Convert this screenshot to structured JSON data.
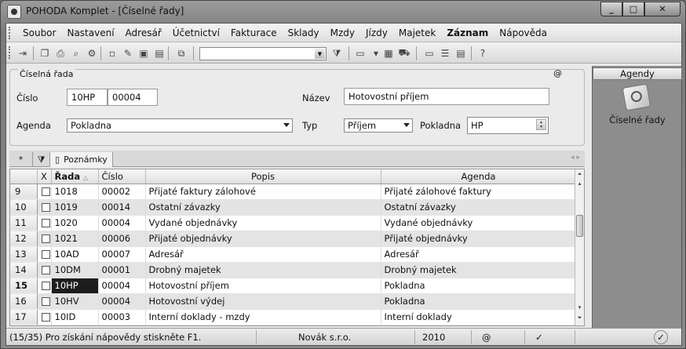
{
  "window": {
    "title": "POHODA Komplet - [Číselné řady]",
    "minimize": "_",
    "maximize": "□",
    "close": "✕"
  },
  "menu": {
    "items": [
      "Soubor",
      "Nastavení",
      "Adresář",
      "Účetnictví",
      "Fakturace",
      "Sklady",
      "Mzdy",
      "Jízdy",
      "Majetek",
      "Záznam",
      "Nápověda"
    ]
  },
  "form": {
    "section_title": "Číselná řada",
    "at_symbol": "@",
    "cislo_label": "Číslo",
    "cislo_rada": "10HP",
    "cislo_number": "00004",
    "nazev_label": "Název",
    "nazev_value": "Hotovostní příjem",
    "agenda_label": "Agenda",
    "agenda_value": "Pokladna",
    "typ_label": "Typ",
    "typ_value": "Příjem",
    "pokladna_label": "Pokladna",
    "pokladna_value": "HP"
  },
  "sidebar": {
    "header": "Agendy",
    "item_label": "Číselné řady"
  },
  "tabs": {
    "star": "*",
    "notes": "Poznámky"
  },
  "table": {
    "columns": [
      "X",
      "Řada",
      "Číslo",
      "Popis",
      "Agenda"
    ],
    "rows": [
      {
        "n": "9",
        "rada": "1018",
        "cislo": "00002",
        "popis": "Přijaté faktury zálohové",
        "agenda": "Přijaté zálohové faktury"
      },
      {
        "n": "10",
        "rada": "1019",
        "cislo": "00014",
        "popis": "Ostatní závazky",
        "agenda": "Ostatní závazky"
      },
      {
        "n": "11",
        "rada": "1020",
        "cislo": "00004",
        "popis": "Vydané objednávky",
        "agenda": "Vydané objednávky"
      },
      {
        "n": "12",
        "rada": "1021",
        "cislo": "00006",
        "popis": "Přijaté objednávky",
        "agenda": "Přijaté objednávky"
      },
      {
        "n": "13",
        "rada": "10AD",
        "cislo": "00007",
        "popis": "Adresář",
        "agenda": "Adresář"
      },
      {
        "n": "14",
        "rada": "10DM",
        "cislo": "00001",
        "popis": "Drobný majetek",
        "agenda": "Drobný majetek"
      },
      {
        "n": "15",
        "rada": "10HP",
        "cislo": "00004",
        "popis": "Hotovostní příjem",
        "agenda": "Pokladna"
      },
      {
        "n": "16",
        "rada": "10HV",
        "cislo": "00004",
        "popis": "Hotovostní výdej",
        "agenda": "Pokladna"
      },
      {
        "n": "17",
        "rada": "10ID",
        "cislo": "00003",
        "popis": "Interní doklady - mzdy",
        "agenda": "Interní doklady"
      }
    ],
    "selected_index": 6
  },
  "status": {
    "help": "(15/35) Pro získání nápovědy stiskněte F1.",
    "company": "Novák  s.r.o.",
    "year": "2010",
    "at": "@"
  }
}
